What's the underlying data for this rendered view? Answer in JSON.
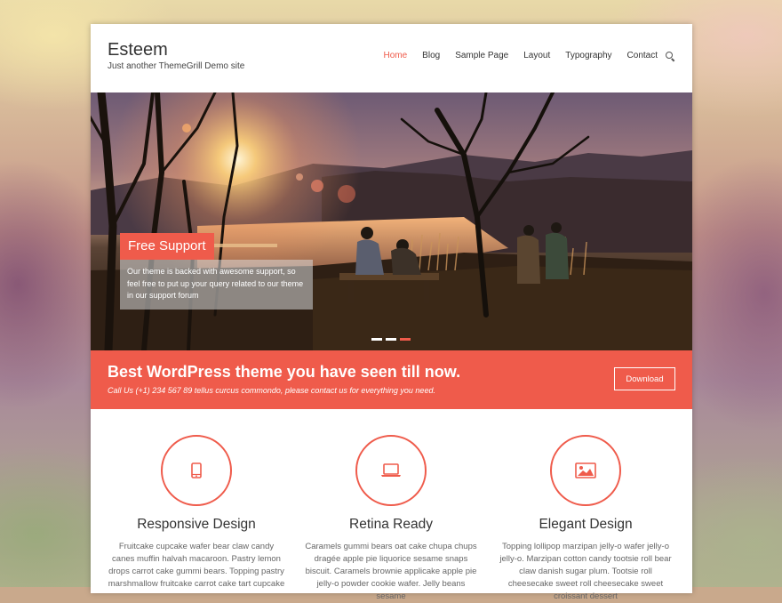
{
  "site": {
    "title": "Esteem",
    "description": "Just another ThemeGrill Demo site"
  },
  "nav": {
    "items": [
      {
        "label": "Home",
        "active": true
      },
      {
        "label": "Blog"
      },
      {
        "label": "Sample Page"
      },
      {
        "label": "Layout"
      },
      {
        "label": "Typography"
      },
      {
        "label": "Contact"
      }
    ],
    "search_icon": "search-icon"
  },
  "slider": {
    "title": "Free Support",
    "text": "Our theme is backed with awesome support, so feel free to put up your query related to our theme in our support forum",
    "dot_count": 3,
    "active_dot": 3
  },
  "cta": {
    "title": "Best WordPress theme you have seen till now.",
    "subtitle": "Call Us (+1) 234 567 89 tellus curcus commondo, please contact us for everything you need.",
    "button_label": "Download"
  },
  "features": [
    {
      "icon": "mobile-icon",
      "title": "Responsive Design",
      "text": "Fruitcake cupcake wafer bear claw candy canes muffin halvah macaroon. Pastry lemon drops carrot cake gummi bears. Topping pastry marshmallow fruitcake carrot cake tart cupcake"
    },
    {
      "icon": "laptop-icon",
      "title": "Retina Ready",
      "text": "Caramels gummi bears oat cake chupa chups dragée apple pie liquorice sesame snaps biscuit. Caramels brownie applicake apple pie jelly-o powder cookie wafer. Jelly beans sesame"
    },
    {
      "icon": "image-icon",
      "title": "Elegant Design",
      "text": "Topping lollipop marzipan jelly-o wafer jelly-o jelly-o. Marzipan cotton candy tootsie roll bear claw danish sugar plum. Tootsie roll cheesecake sweet roll cheesecake sweet croissant dessert"
    }
  ],
  "colors": {
    "accent": "#ef5b4b",
    "text": "#333333",
    "muted": "#666666"
  }
}
